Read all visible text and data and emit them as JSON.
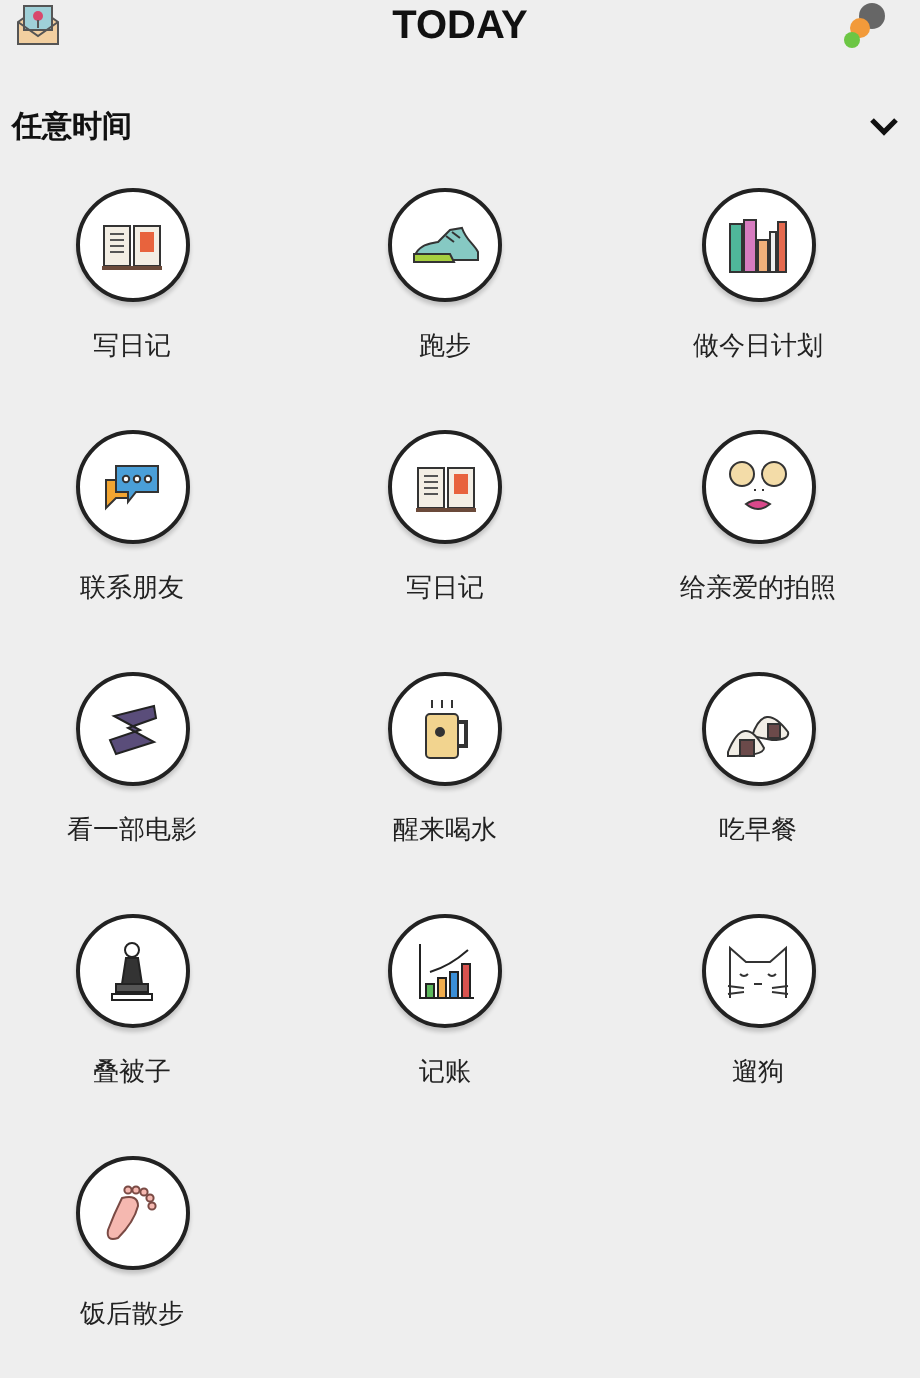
{
  "header": {
    "title": "TODAY"
  },
  "section": {
    "title": "任意时间",
    "expanded": true,
    "items": [
      {
        "label": "写日记"
      },
      {
        "label": "跑步"
      },
      {
        "label": "做今日计划"
      },
      {
        "label": "联系朋友"
      },
      {
        "label": "写日记"
      },
      {
        "label": "给亲爱的拍照"
      },
      {
        "label": "看一部电影"
      },
      {
        "label": "醒来喝水"
      },
      {
        "label": "吃早餐"
      },
      {
        "label": "叠被子"
      },
      {
        "label": "记账"
      },
      {
        "label": "遛狗"
      },
      {
        "label": "饭后散步"
      }
    ]
  }
}
